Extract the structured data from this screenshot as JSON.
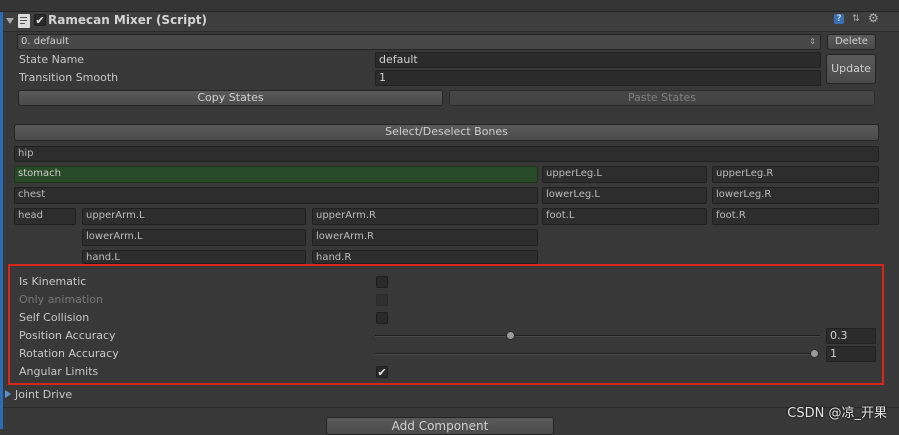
{
  "component": {
    "title": "Ramecan Mixer (Script)",
    "enabled_check": "✔"
  },
  "state_bar": {
    "selected_state": "0. default",
    "delete_label": "Delete"
  },
  "fields": {
    "state_name_label": "State Name",
    "state_name_value": "default",
    "transition_label": "Transition Smooth",
    "transition_value": "1",
    "update_label": "Update",
    "copy_label": "Copy States",
    "paste_label": "Paste States"
  },
  "bones": {
    "select_label": "Select/Deselect Bones",
    "hip": "hip",
    "stomach": "stomach",
    "chest": "chest",
    "head": "head",
    "upperArm_L": "upperArm.L",
    "upperArm_R": "upperArm.R",
    "lowerArm_L": "lowerArm.L",
    "lowerArm_R": "lowerArm.R",
    "hand_L": "hand.L",
    "hand_R": "hand.R",
    "upperLeg_L": "upperLeg.L",
    "upperLeg_R": "upperLeg.R",
    "lowerLeg_L": "lowerLeg.L",
    "lowerLeg_R": "lowerLeg.R",
    "foot_L": "foot.L",
    "foot_R": "foot.R"
  },
  "properties": {
    "is_kinematic": {
      "label": "Is Kinematic",
      "checked": false
    },
    "only_animation": {
      "label": "Only animation",
      "checked": false,
      "disabled": true
    },
    "self_collision": {
      "label": "Self Collision",
      "checked": false
    },
    "position_accuracy": {
      "label": "Position Accuracy",
      "value": "0.3",
      "fraction": 0.3
    },
    "rotation_accuracy": {
      "label": "Rotation Accuracy",
      "value": "1",
      "fraction": 1.0
    },
    "angular_limits": {
      "label": "Angular Limits",
      "checked": true,
      "mark": "✔"
    }
  },
  "joint_drive": {
    "label": "Joint Drive"
  },
  "add_component": {
    "label": "Add Component"
  },
  "watermark": "CSDN @凉_开果",
  "colors": {
    "highlight_border": "#d9261c",
    "selected_bone": "#284a26",
    "editor_bg": "#383838"
  },
  "icons": [
    "foldout-arrow-icon",
    "script-icon",
    "help-icon",
    "presets-icon",
    "gear-icon",
    "dropdown-arrows-icon",
    "checkmark-icon"
  ]
}
